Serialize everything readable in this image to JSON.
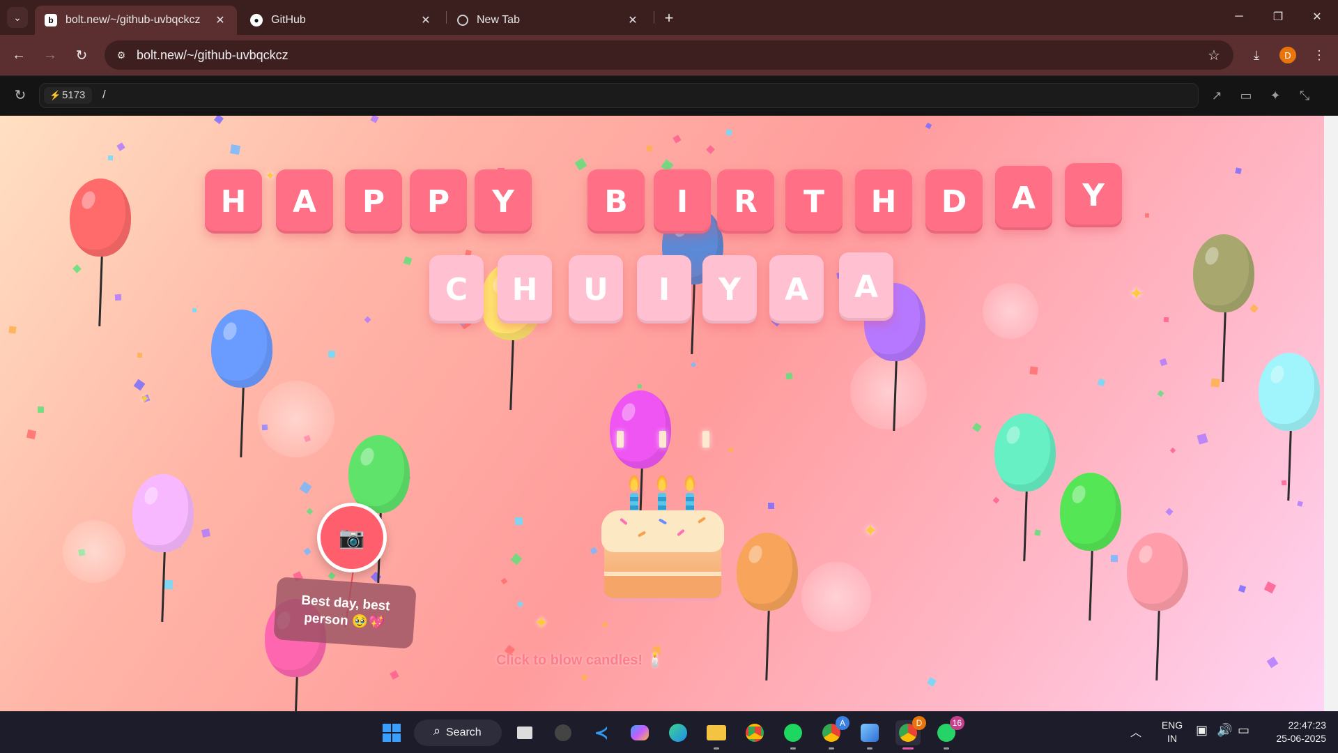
{
  "browser": {
    "tabs": [
      {
        "title": "bolt.new/~/github-uvbqckcz",
        "favicon": "bolt-icon",
        "active": true
      },
      {
        "title": "GitHub",
        "favicon": "github-icon",
        "active": false
      },
      {
        "title": "New Tab",
        "favicon": "chrome-icon",
        "active": false
      }
    ],
    "url": "bolt.new/~/github-uvbqckcz",
    "profile_initial": "D"
  },
  "preview": {
    "port": "5173",
    "path": "/"
  },
  "page": {
    "title_row1": [
      "H",
      "A",
      "P",
      "P",
      "Y",
      "B",
      "I",
      "R",
      "T",
      "H",
      "D",
      "A",
      "Y"
    ],
    "title_row2": [
      "C",
      "H",
      "U",
      "I",
      "Y",
      "A",
      "A"
    ],
    "camera_icon": "📷",
    "note": "Best day, best person 🥹💖",
    "hint": "Click to blow candles! 🕯️",
    "colors": {
      "letter_row1": "#ff6f86",
      "letter_row2": "#ffc0d2",
      "camera_button": "#ff5f6d"
    },
    "balloon_colors": [
      "#ff6b6b",
      "#6a9cff",
      "#f7b8ff",
      "#5fe36a",
      "#ffe66d",
      "#5c8ad6",
      "#b678ff",
      "#ee55f2",
      "#ff66b0",
      "#f8a45b",
      "#66f0c4",
      "#55e655",
      "#ff9eaa",
      "#a8a86e",
      "#9ff5fb"
    ]
  },
  "taskbar": {
    "search_label": "Search",
    "whatsapp_badge": "16",
    "chrome_badge_a": "A",
    "chrome_badge_d": "D",
    "lang_top": "ENG",
    "lang_bottom": "IN",
    "time": "22:47:23",
    "date": "25-06-2025"
  }
}
